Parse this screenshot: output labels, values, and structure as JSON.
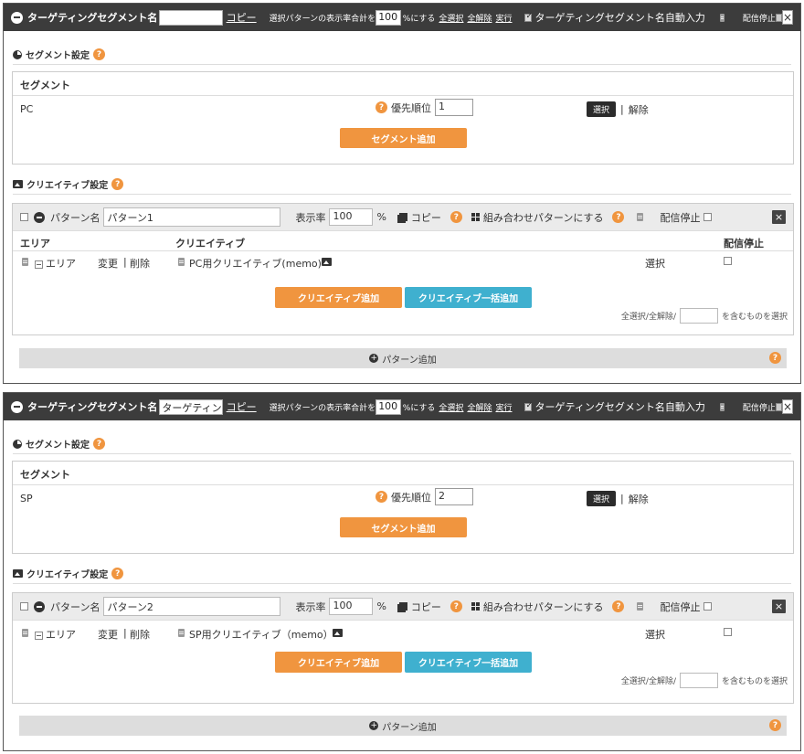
{
  "blocks": [
    {
      "header": {
        "title": "ターゲティングセグメント名",
        "name_value": "",
        "copy_label": "コピー",
        "rate_prefix": "選択パターンの表示率合計を",
        "rate_value": "100",
        "rate_suffix": "%にする",
        "select_all": "全選択",
        "deselect_all": "全解除",
        "execute": "実行",
        "auto_input_label": "ターゲティングセグメント名自動入力",
        "stop_label": "配信停止",
        "close": "×"
      },
      "segment_section": {
        "title": "セグメント設定",
        "column_header": "セグメント",
        "segment_name": "PC",
        "priority_label": "優先順位",
        "priority_value": "1",
        "select_btn": "選択",
        "separator": "|",
        "remove_link": "解除",
        "add_btn": "セグメント追加"
      },
      "creative_section": {
        "title": "クリエイティブ設定",
        "pattern": {
          "name_label": "パターン名",
          "name_value": "パターン1",
          "rate_label": "表示率",
          "rate_value": "100",
          "percent": "%",
          "copy": "コピー",
          "combo": "組み合わせパターンにする",
          "stop": "配信停止",
          "close": "×"
        },
        "columns": {
          "area": "エリア",
          "creative": "クリエイティブ",
          "stop": "配信停止"
        },
        "row": {
          "area": "エリア",
          "change": "変更",
          "separator": "|",
          "delete": "削除",
          "creative": "PC用クリエイティブ(memo)",
          "select": "選択"
        },
        "add_creative": "クリエイティブ追加",
        "bulk_add": "クリエイティブ一括追加",
        "filter_prefix": "全選択/全解除/",
        "filter_suffix": "を含むものを選択",
        "add_pattern": "パターン追加"
      }
    },
    {
      "header": {
        "title": "ターゲティングセグメント名",
        "name_value": "ターゲティングセグ",
        "copy_label": "コピー",
        "rate_prefix": "選択パターンの表示率合計を",
        "rate_value": "100",
        "rate_suffix": "%にする",
        "select_all": "全選択",
        "deselect_all": "全解除",
        "execute": "実行",
        "auto_input_label": "ターゲティングセグメント名自動入力",
        "stop_label": "配信停止",
        "close": "×"
      },
      "segment_section": {
        "title": "セグメント設定",
        "column_header": "セグメント",
        "segment_name": "SP",
        "priority_label": "優先順位",
        "priority_value": "2",
        "select_btn": "選択",
        "separator": "|",
        "remove_link": "解除",
        "add_btn": "セグメント追加"
      },
      "creative_section": {
        "title": "クリエイティブ設定",
        "pattern": {
          "name_label": "パターン名",
          "name_value": "パターン2",
          "rate_label": "表示率",
          "rate_value": "100",
          "percent": "%",
          "copy": "コピー",
          "combo": "組み合わせパターンにする",
          "stop": "配信停止",
          "close": "×"
        },
        "row": {
          "area": "エリア",
          "change": "変更",
          "separator": "|",
          "delete": "削除",
          "creative": "SP用クリエイティブ（memo）",
          "select": "選択"
        },
        "add_creative": "クリエイティブ追加",
        "bulk_add": "クリエイティブ一括追加",
        "filter_prefix": "全選択/全解除/",
        "filter_suffix": "を含むものを選択",
        "add_pattern": "パターン追加"
      }
    }
  ],
  "colors": {
    "accent_orange": "#f0953f",
    "accent_blue": "#3fb0cf",
    "header_dark": "#3c3c3c"
  }
}
